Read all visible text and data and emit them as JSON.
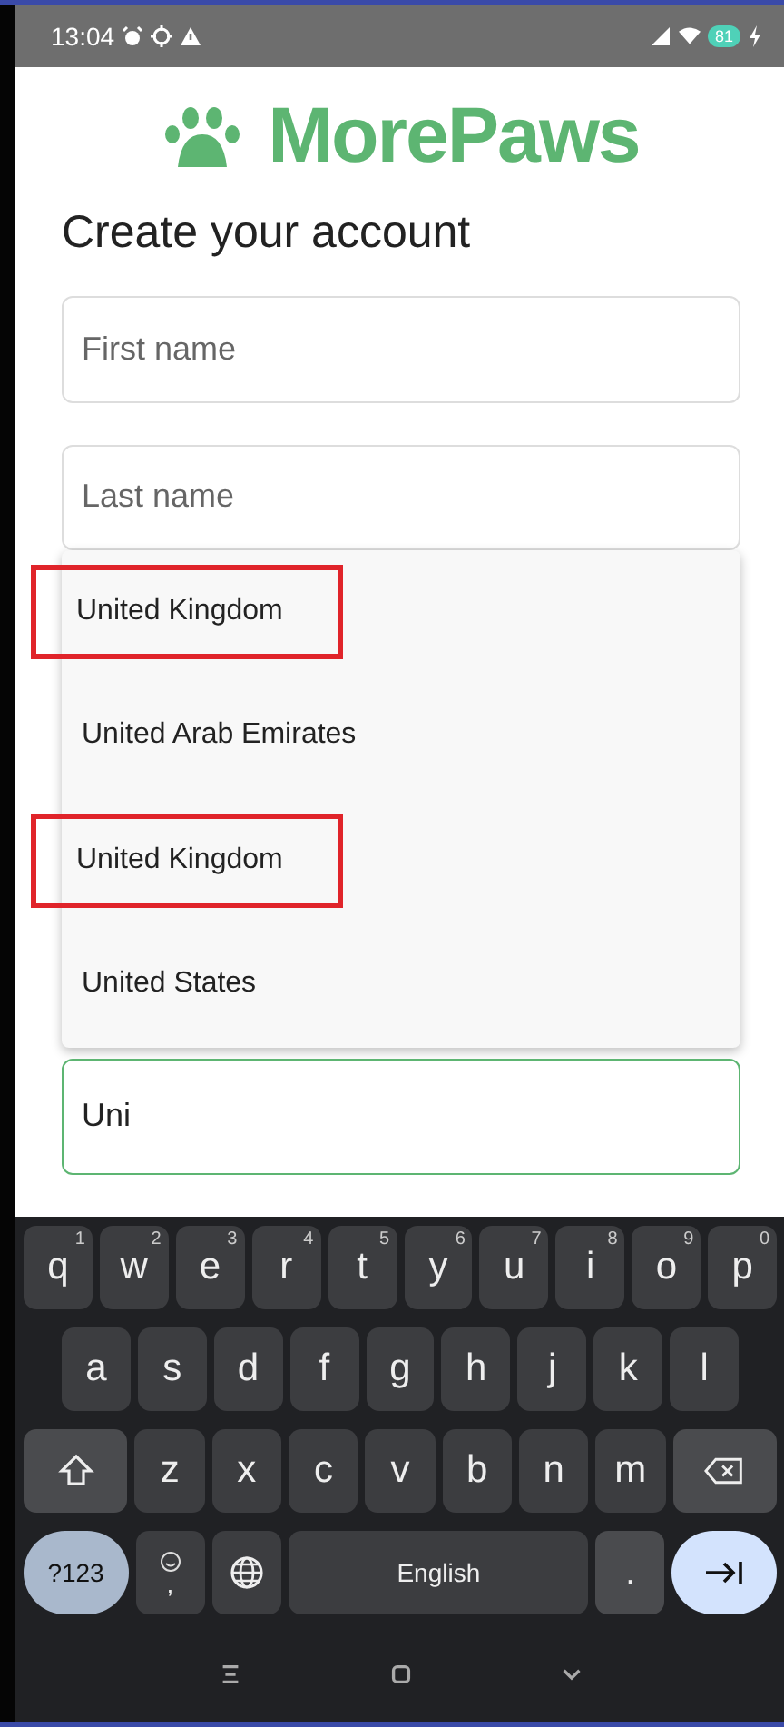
{
  "status_bar": {
    "time": "13:04",
    "battery": "81"
  },
  "logo": "MorePaws",
  "heading": "Create your account",
  "fields": [
    {
      "placeholder": "First name"
    },
    {
      "placeholder": "Last name"
    }
  ],
  "dropdown": {
    "options": [
      {
        "label": "United Kingdom",
        "highlighted": true
      },
      {
        "label": "United Arab Emirates",
        "highlighted": false
      },
      {
        "label": "United Kingdom",
        "highlighted": true
      },
      {
        "label": "United States",
        "highlighted": false
      }
    ]
  },
  "country_field": {
    "value": "Uni",
    "focused": true
  },
  "keyboard": {
    "rows": [
      {
        "keys": [
          {
            "key": "q",
            "hint": "1"
          },
          {
            "key": "w",
            "hint": "2"
          },
          {
            "key": "e",
            "hint": "3"
          },
          {
            "key": "r",
            "hint": "4"
          },
          {
            "key": "t",
            "hint": "5"
          },
          {
            "key": "y",
            "hint": "6"
          },
          {
            "key": "u",
            "hint": "7"
          },
          {
            "key": "i",
            "hint": "8"
          },
          {
            "key": "o",
            "hint": "9"
          },
          {
            "key": "p",
            "hint": "0"
          }
        ]
      },
      {
        "keys": [
          {
            "key": "a"
          },
          {
            "key": "s"
          },
          {
            "key": "d"
          },
          {
            "key": "f"
          },
          {
            "key": "g"
          },
          {
            "key": "h"
          },
          {
            "key": "j"
          },
          {
            "key": "k"
          },
          {
            "key": "l"
          }
        ]
      },
      {
        "keys": [
          {
            "kind": "shift"
          },
          {
            "key": "z"
          },
          {
            "key": "x"
          },
          {
            "key": "c"
          },
          {
            "key": "v"
          },
          {
            "key": "b"
          },
          {
            "key": "n"
          },
          {
            "key": "m"
          },
          {
            "kind": "backspace"
          }
        ]
      },
      {
        "keys": [
          {
            "kind": "symbols",
            "key": "?123"
          },
          {
            "kind": "emoji",
            "key": ","
          },
          {
            "kind": "globe"
          },
          {
            "kind": "space",
            "key": "English"
          },
          {
            "kind": "period",
            "key": "."
          },
          {
            "kind": "enter"
          }
        ]
      }
    ]
  }
}
